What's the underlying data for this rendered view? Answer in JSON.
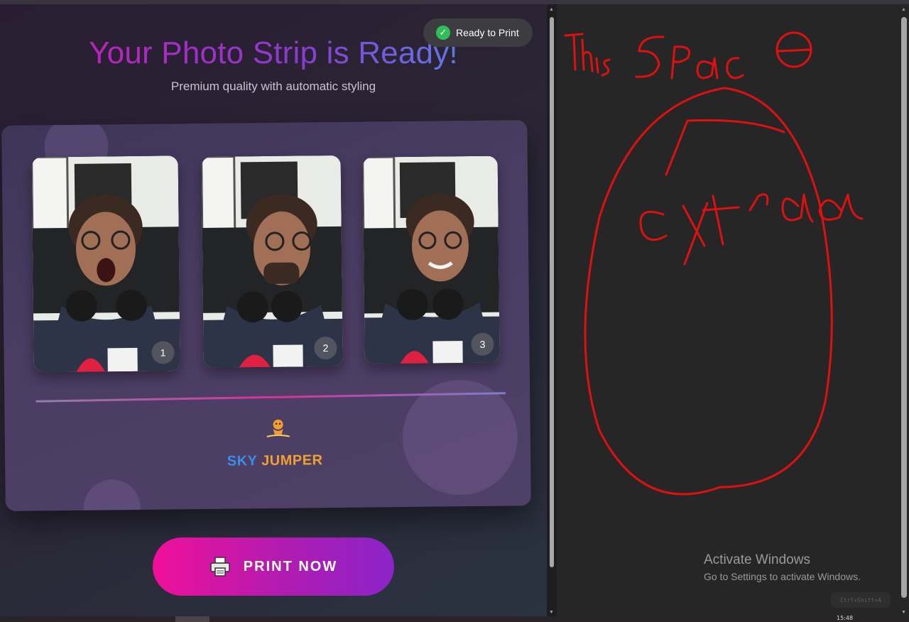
{
  "header": {
    "title": "Your Photo Strip is Ready!",
    "subtitle": "Premium quality with automatic styling",
    "status_badge": "Ready to Print",
    "status_color": "#2fbf5a"
  },
  "photos": [
    {
      "number": "1",
      "description": "open-mouth"
    },
    {
      "number": "2",
      "description": "looking-aside"
    },
    {
      "number": "3",
      "description": "smiling"
    }
  ],
  "branding": {
    "word1": "SKY",
    "word2": "JUMPER",
    "icon": "jumper-mascot-icon",
    "color1": "#3a8ee8",
    "color2": "#f0a030"
  },
  "actions": {
    "print_label": "PRINT NOW",
    "print_icon": "printer-icon"
  },
  "annotation": {
    "note_line1": "This space",
    "note_line2": "extra",
    "ink_color": "#e01010"
  },
  "system": {
    "activate_title": "Activate Windows",
    "activate_sub": "Go to Settings to activate Windows.",
    "shortcut": "Ctrl+Shift+A",
    "clock": "15:48"
  },
  "colors": {
    "accent_pink": "#f0109a",
    "accent_purple": "#8a24c8"
  }
}
